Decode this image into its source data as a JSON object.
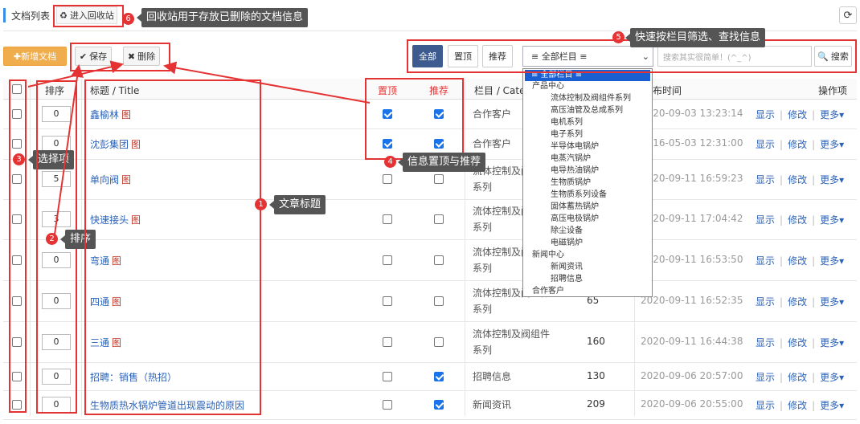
{
  "header": {
    "title": "文档列表",
    "recycle_btn": "进入回收站",
    "refresh_icon": "refresh-icon"
  },
  "toolbar": {
    "new_btn": "✚新增文档",
    "save_btn": "保存",
    "delete_btn": "删除"
  },
  "filter": {
    "seg_all": "全部",
    "seg_top": "置顶",
    "seg_recommend": "推荐",
    "category_selected": "≡ 全部栏目 ≡",
    "search_placeholder": "搜索其实很简单！(^_^)",
    "search_btn": "搜索"
  },
  "columns": {
    "sort": "排序",
    "title": "标题 / Title",
    "top": "置顶",
    "recommend": "推荐",
    "category": "栏目 / Categ",
    "time": "布时间",
    "ops": "操作项"
  },
  "rows": [
    {
      "sort": "0",
      "title": "鑫榆林",
      "pic": "图",
      "top": true,
      "rec": true,
      "cat": "合作客户",
      "num": "",
      "time": "2020-09-03 13:23:14"
    },
    {
      "sort": "0",
      "title": "沈彭集团",
      "pic": "图",
      "top": true,
      "rec": true,
      "cat": "合作客户",
      "num": "",
      "time": "2016-05-03 12:31:00"
    },
    {
      "sort": "5",
      "title": "单向阀",
      "pic": "图",
      "top": false,
      "rec": false,
      "cat": "流体控制及阀组件系列",
      "num": "",
      "time": "2020-09-11 16:59:23"
    },
    {
      "sort": "3",
      "title": "快速接头",
      "pic": "图",
      "top": false,
      "rec": false,
      "cat": "流体控制及阀组件系列",
      "num": "",
      "time": "2020-09-11 17:04:42"
    },
    {
      "sort": "0",
      "title": "弯通",
      "pic": "图",
      "top": false,
      "rec": false,
      "cat": "流体控制及阀组件系列",
      "num": "",
      "time": "2020-09-11 16:53:50"
    },
    {
      "sort": "0",
      "title": "四通",
      "pic": "图",
      "top": false,
      "rec": false,
      "cat": "流体控制及阀组件系列",
      "num": "65",
      "time": "2020-09-11 16:52:35"
    },
    {
      "sort": "0",
      "title": "三通",
      "pic": "图",
      "top": false,
      "rec": false,
      "cat": "流体控制及阀组件系列",
      "num": "160",
      "time": "2020-09-11 16:44:38"
    },
    {
      "sort": "0",
      "title": "招聘：销售（热招）",
      "pic": "",
      "top": false,
      "rec": true,
      "cat": "招聘信息",
      "num": "130",
      "time": "2020-09-06 20:57:00"
    },
    {
      "sort": "0",
      "title": "生物质热水锅炉管道出现震动的原因",
      "pic": "",
      "top": false,
      "rec": true,
      "cat": "新闻资讯",
      "num": "209",
      "time": "2020-09-06 20:55:00"
    }
  ],
  "row_ops": {
    "show": "显示",
    "edit": "修改",
    "more": "更多▾"
  },
  "dropdown": {
    "selected": "≡ 全部栏目 ≡",
    "items": [
      {
        "label": "产品中心",
        "level": 1
      },
      {
        "label": "流体控制及阀组件系列",
        "level": 2
      },
      {
        "label": "高压油管及总成系列",
        "level": 2
      },
      {
        "label": "电机系列",
        "level": 2
      },
      {
        "label": "电子系列",
        "level": 2
      },
      {
        "label": "半导体电锅炉",
        "level": 2
      },
      {
        "label": "电蒸汽锅炉",
        "level": 2
      },
      {
        "label": "电导热油锅炉",
        "level": 2
      },
      {
        "label": "生物质锅炉",
        "level": 2
      },
      {
        "label": "生物质系列设备",
        "level": 2
      },
      {
        "label": "固体蓄热锅炉",
        "level": 2
      },
      {
        "label": "高压电极锅炉",
        "level": 2
      },
      {
        "label": "除尘设备",
        "level": 2
      },
      {
        "label": "电磁锅炉",
        "level": 2
      },
      {
        "label": "新闻中心",
        "level": 1
      },
      {
        "label": "新闻资讯",
        "level": 2
      },
      {
        "label": "招聘信息",
        "level": 2
      },
      {
        "label": "合作客户",
        "level": 1
      }
    ]
  },
  "annotations": {
    "n1": "1",
    "t1": "文章标题",
    "n2": "2",
    "t2": "排序",
    "n3": "3",
    "t3": "选择项",
    "n4": "4",
    "t4": "信息置顶与推荐",
    "n5": "5",
    "t5": "快速按栏目筛选、查找信息",
    "n6": "6",
    "t6": "回收站用于存放已删除的文档信息"
  },
  "colors": {
    "accent": "#3d5b8f",
    "annotation": "#e53333",
    "link": "#2b62b8",
    "new_btn": "#f0ad4e"
  }
}
